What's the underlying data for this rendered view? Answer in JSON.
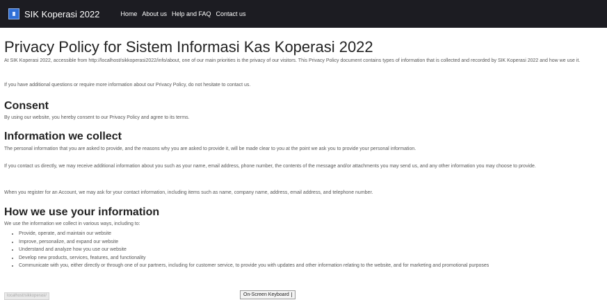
{
  "navbar": {
    "brand": "SIK Koperasi 2022",
    "links": [
      "Home",
      "About us",
      "Help and FAQ",
      "Contact us"
    ]
  },
  "page": {
    "title": "Privacy Policy for Sistem Informasi Kas Koperasi 2022",
    "intro": "At SIK Koperasi 2022, accessible from http://localhost/sikkoperasi2022/info/about, one of our main priorities is the privacy of our visitors. This Privacy Policy document contains types of information that is collected and recorded by SIK Koperasi 2022 and how we use it.",
    "contact": "If you have additional questions or require more information about our Privacy Policy, do not hesitate to contact us.",
    "consent": {
      "heading": "Consent",
      "text": "By using our website, you hereby consent to our Privacy Policy and agree to its terms."
    },
    "collect": {
      "heading": "Information we collect",
      "p1": "The personal information that you are asked to provide, and the reasons why you are asked to provide it, will be made clear to you at the point we ask you to provide your personal information.",
      "p2": "If you contact us directly, we may receive additional information about you such as your name, email address, phone number, the contents of the message and/or attachments you may send us, and any other information you may choose to provide.",
      "p3": "When you register for an Account, we may ask for your contact information, including items such as name, company name, address, email address, and telephone number."
    },
    "use": {
      "heading": "How we use your information",
      "intro": "We use the information we collect in various ways, including to:",
      "items": [
        "Provide, operate, and maintain our website",
        "Improve, personalize, and expand our website",
        "Understand and analyze how you use our website",
        "Develop new products, services, features, and functionality",
        "Communicate with you, either directly or through one of our partners, including for customer service, to provide you with updates and other information relating to the website, and for marketing and promotional purposes"
      ]
    }
  },
  "statusbar": {
    "url": "localhost/sikkoperasi/"
  },
  "osk": {
    "label": "On-Screen Keyboard"
  }
}
